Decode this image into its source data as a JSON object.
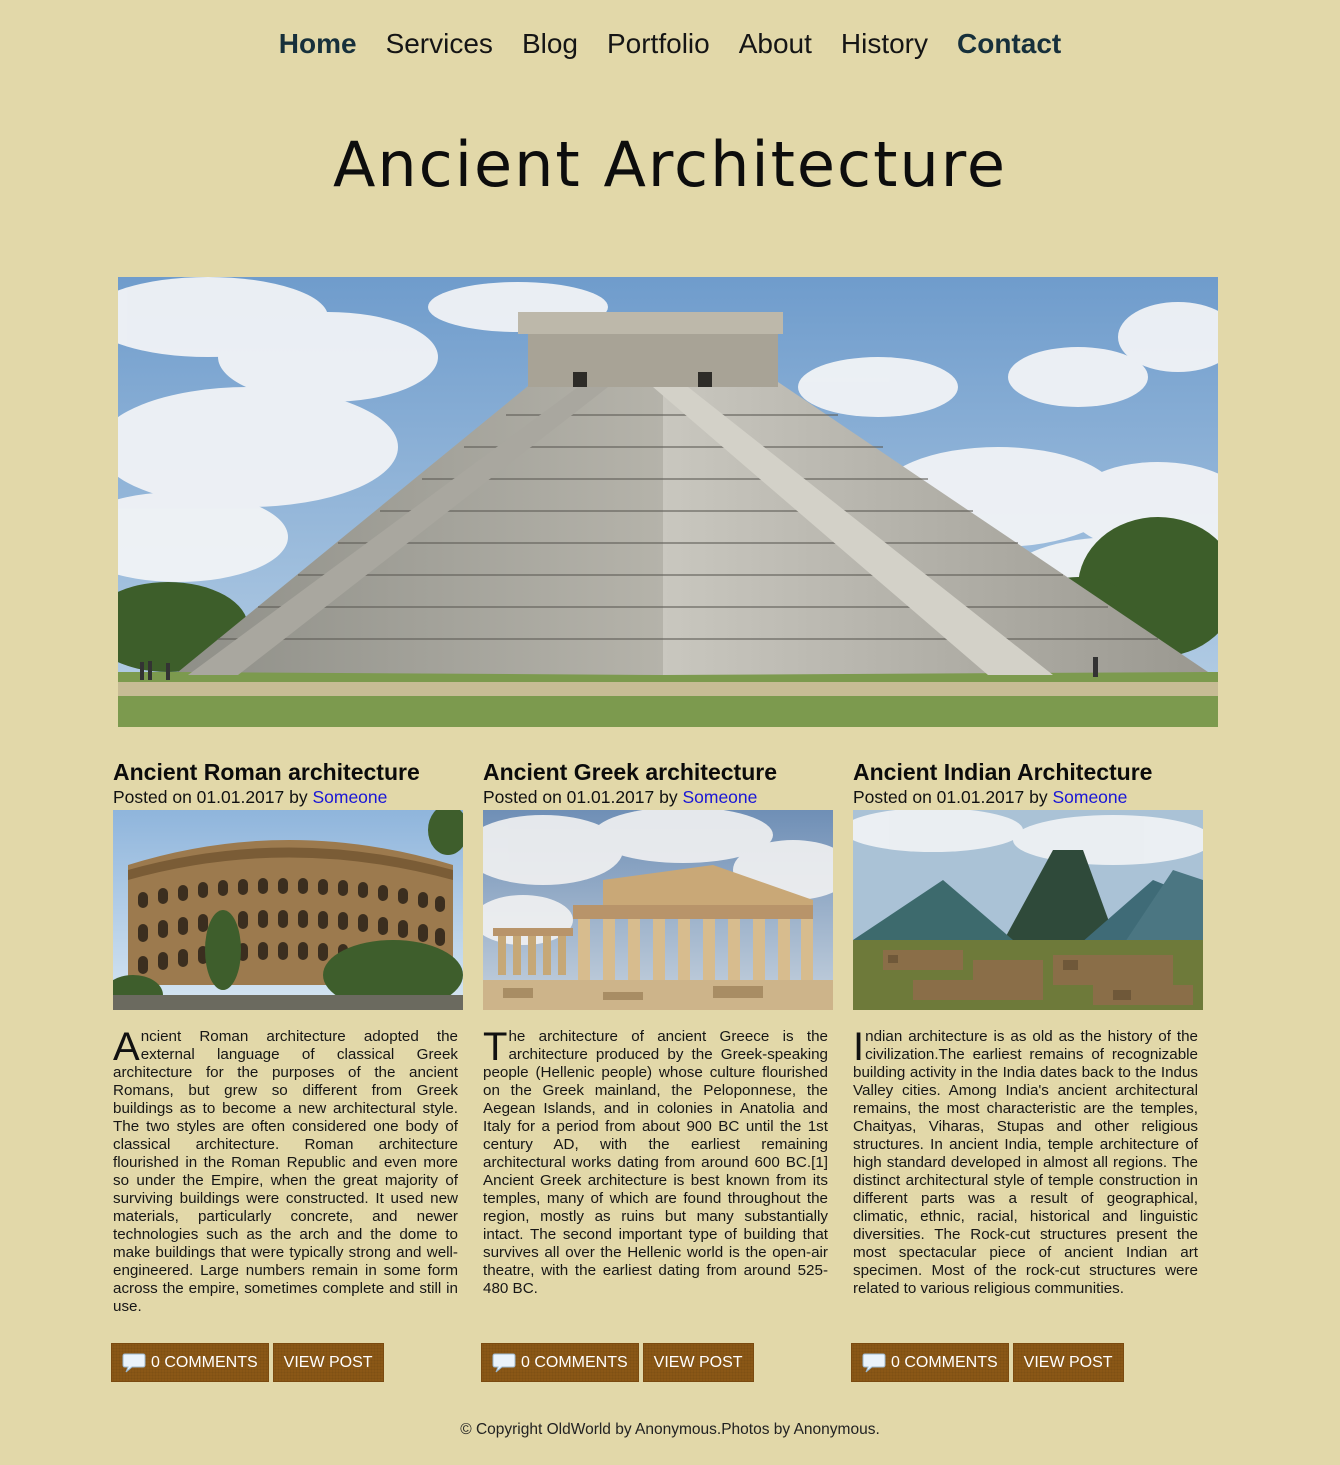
{
  "nav": {
    "items": [
      "Home",
      "Services",
      "Blog",
      "Portfolio",
      "About",
      "History",
      "Contact"
    ]
  },
  "page_title": "Ancient Architecture",
  "posts": [
    {
      "title": "Ancient Roman architecture",
      "posted_prefix": "Posted on 01.01.2017 by ",
      "author": "Someone",
      "dropcap": "A",
      "body": "ncient Roman architecture adopted the external language of classical Greek architecture for the purposes of the ancient Romans, but grew so different from Greek buildings as to become a new architectural style. The two styles are often considered one body of classical architecture. Roman architecture flourished in the Roman Republic and even more so under the Empire, when the great majority of surviving buildings were constructed. It used new materials, particularly concrete, and newer technologies such as the arch and the dome to make buildings that were typically strong and well-engineered. Large numbers remain in some form across the empire, sometimes complete and still in use.",
      "comments_label": "0 COMMENTS",
      "view_label": "VIEW POST"
    },
    {
      "title": "Ancient Greek architecture",
      "posted_prefix": "Posted on 01.01.2017 by ",
      "author": "Someone",
      "dropcap": "T",
      "body": "he architecture of ancient Greece is the architecture produced by the Greek-speaking people (Hellenic people) whose culture flourished on the Greek mainland, the Peloponnese, the Aegean Islands, and in colonies in Anatolia and Italy for a period from about 900 BC until the 1st century AD, with the earliest remaining architectural works dating from around 600 BC.[1] Ancient Greek architecture is best known from its temples, many of which are found throughout the region, mostly as ruins but many substantially intact. The second important type of building that survives all over the Hellenic world is the open-air theatre, with the earliest dating from around 525-480 BC.",
      "comments_label": "0 COMMENTS",
      "view_label": "VIEW POST"
    },
    {
      "title": "Ancient Indian Architecture",
      "posted_prefix": "Posted on 01.01.2017 by ",
      "author": "Someone",
      "dropcap": "I",
      "body": "ndian architecture is as old as the history of the civilization.The earliest remains of recognizable building activity in the India dates back to the Indus Valley cities. Among India's ancient architectural remains, the most characteristic are the temples, Chaityas, Viharas, Stupas and other religious structures. In ancient India, temple architecture of high standard developed in almost all regions. The distinct architectural style of temple construction in different parts was a result of geographical, climatic, ethnic, racial, historical and linguistic diversities. The Rock-cut structures present the most spectacular piece of ancient Indian art specimen. Most of the rock-cut structures were related to various religious communities.",
      "comments_label": "0 COMMENTS",
      "view_label": "VIEW POST"
    }
  ],
  "footer": "© Copyright OldWorld by Anonymous.Photos by Anonymous.",
  "colors": {
    "background": "#e2d8a9",
    "button": "#8a5716",
    "author_link": "#1a16d6",
    "nav_active": "#17303b"
  }
}
